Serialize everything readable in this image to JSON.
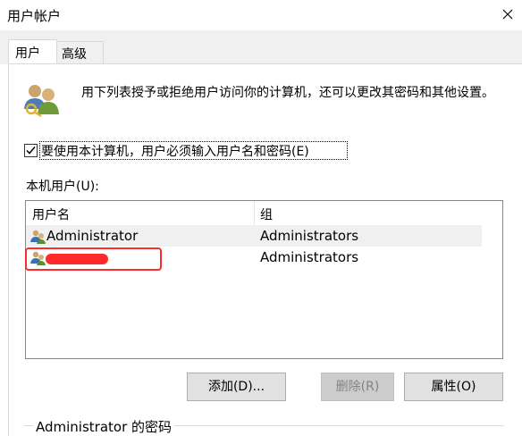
{
  "window": {
    "title": "用户帐户",
    "close_icon": "close-icon"
  },
  "tabs": [
    {
      "label": "用户",
      "selected": true
    },
    {
      "label": "高级",
      "selected": false
    }
  ],
  "description": "用下列表授予或拒绝用户访问你的计算机，还可以更改其密码和其他设置。",
  "require_password": {
    "label": "要使用本计算机，用户必须输入用户名和密码(E)",
    "checked": true
  },
  "local_users": {
    "label": "本机用户(U):",
    "columns": [
      "用户名",
      "组"
    ],
    "rows": [
      {
        "name": "Administrator",
        "group": "Administrators"
      },
      {
        "name": "",
        "group": "Administrators",
        "redacted": true
      }
    ]
  },
  "buttons": {
    "add": "添加(D)...",
    "delete": "删除(R)",
    "properties": "属性(O)"
  },
  "password_section": {
    "label": "Administrator 的密码"
  },
  "colors": {
    "redaction": "#ff2a2a",
    "button_face": "#e1e1e1",
    "tab_strip": "#f0f0f0"
  }
}
